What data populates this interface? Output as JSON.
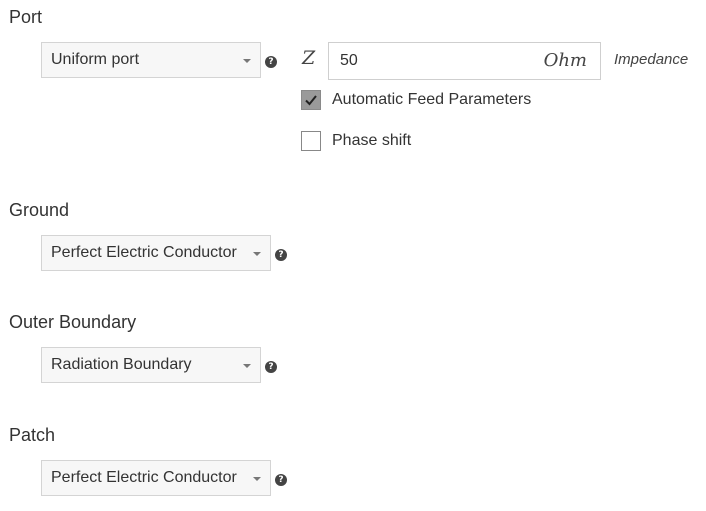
{
  "port": {
    "title": "Port",
    "type_select": "Uniform port",
    "impedance_symbol": "Z",
    "impedance_value": "50",
    "impedance_unit": "Ohm",
    "impedance_label": "Impedance",
    "auto_feed": {
      "label": "Automatic Feed Parameters",
      "checked": true
    },
    "phase_shift": {
      "label": "Phase shift",
      "checked": false
    }
  },
  "ground": {
    "title": "Ground",
    "select": "Perfect Electric Conductor"
  },
  "outer_boundary": {
    "title": "Outer Boundary",
    "select": "Radiation Boundary"
  },
  "patch": {
    "title": "Patch",
    "select": "Perfect Electric Conductor"
  },
  "help_glyph": "?",
  "icons": {
    "help": "question-circle-icon",
    "caret": "caret-down-icon",
    "check": "checkmark-icon"
  }
}
